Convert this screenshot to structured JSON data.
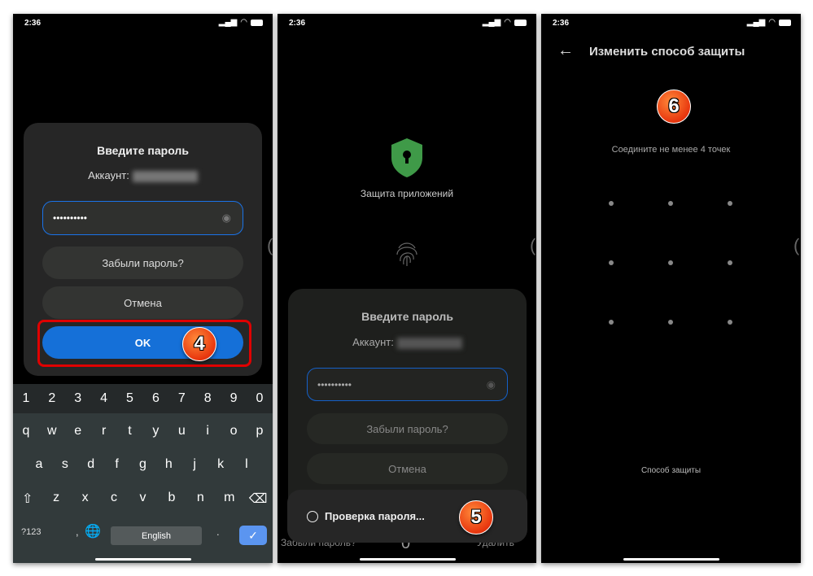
{
  "status": {
    "time": "2:36"
  },
  "panel1": {
    "dialog": {
      "title": "Введите пароль",
      "account_label": "Аккаунт:",
      "password_mask": "••••••••••",
      "forgot": "Забыли пароль?",
      "cancel": "Отмена",
      "ok": "OK"
    },
    "badge": "4",
    "keyboard": {
      "numbers": [
        "1",
        "2",
        "3",
        "4",
        "5",
        "6",
        "7",
        "8",
        "9",
        "0"
      ],
      "row1": [
        "q",
        "w",
        "e",
        "r",
        "t",
        "y",
        "u",
        "i",
        "o",
        "p"
      ],
      "row2": [
        "a",
        "s",
        "d",
        "f",
        "g",
        "h",
        "j",
        "k",
        "l"
      ],
      "row3": [
        "z",
        "x",
        "c",
        "v",
        "b",
        "n",
        "m"
      ],
      "symbols": "?123",
      "comma": ",",
      "space": "English",
      "period": "."
    }
  },
  "panel2": {
    "app_title": "Защита приложений",
    "dialog": {
      "title": "Введите пароль",
      "account_label": "Аккаунт:",
      "password_mask": "••••••••••",
      "forgot": "Забыли пароль?",
      "cancel": "Отмена"
    },
    "toast": "Проверка пароля...",
    "badge": "5",
    "bottom": {
      "forgot": "Забыли пароль?",
      "digit": "0",
      "delete": "Удалить"
    }
  },
  "panel3": {
    "title": "Изменить способ защиты",
    "badge": "6",
    "hint": "Соедините не менее 4 точек",
    "method_link": "Способ защиты"
  },
  "colors": {
    "accent": "#1a73e8",
    "ok_button": "#1570d8",
    "highlight": "#e00000",
    "shield": "#3f9a48"
  }
}
